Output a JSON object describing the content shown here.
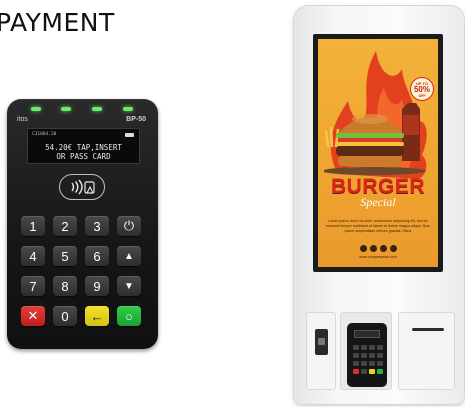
{
  "heading": "PAYMENT",
  "terminal": {
    "brand": "itos",
    "model": "BP-50",
    "screen_id": "C31884.20",
    "display_line1": "54.20€ TAP,INSERT",
    "display_line2": "OR PASS CARD",
    "keys": [
      "1",
      "2",
      "3",
      "⏻",
      "4",
      "5",
      "6",
      "▲",
      "7",
      "8",
      "9",
      "▼",
      "✕",
      "0",
      "←",
      "○"
    ]
  },
  "kiosk": {
    "promo_top": "UP TO",
    "promo_value": "50%",
    "promo_bottom": "OFF",
    "ad_title": "BURGER",
    "ad_subtitle": "Special",
    "ad_body": "Lorem ipsum dolor sit amet, consectetur adipiscing elit, sed do eiusmod tempor incididunt ut labore et dolore magna aliqua. Quis ipsum suspendisse ultrices gravida. Risus",
    "ad_url": "www.companyweb.com"
  },
  "colors": {
    "poster_orange": "#f0a531",
    "title_red": "#d9251c",
    "key_red": "#e63b3b",
    "key_yellow": "#f2e22c",
    "key_green": "#2fcf4a"
  }
}
